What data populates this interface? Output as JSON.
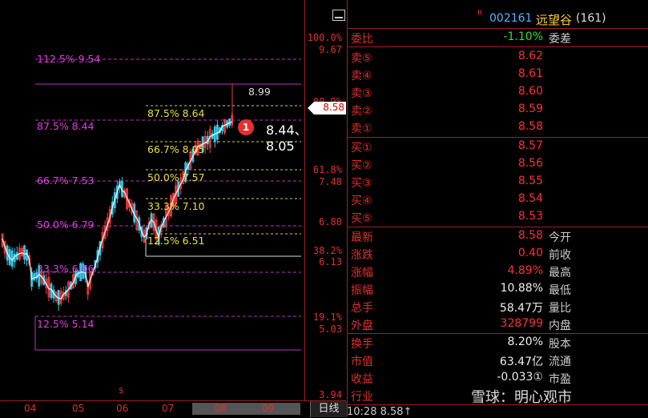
{
  "stock": {
    "code": "002161",
    "name": "远望谷",
    "sub_count": "(161)",
    "r_mark": "R"
  },
  "axis_labels": [
    {
      "text": "100.0%",
      "cls": "red"
    },
    {
      "text": "9.67",
      "cls": "red"
    },
    {
      "text": "80.9%",
      "cls": "red"
    },
    {
      "text": "61.8%",
      "cls": "red"
    },
    {
      "text": "7.48",
      "cls": "red"
    },
    {
      "text": "6.80",
      "cls": "red"
    },
    {
      "text": "38.2%",
      "cls": "red"
    },
    {
      "text": "6.13",
      "cls": "red"
    },
    {
      "text": "19.1%",
      "cls": "red"
    },
    {
      "text": "5.03",
      "cls": "red"
    },
    {
      "text": "3.94",
      "cls": "red"
    }
  ],
  "price_flag": "8.58",
  "fib_outer": [
    "112.5% 9.54",
    "87.5% 8.44",
    "66.7% 7.53",
    "50.0% 6.79",
    "33.3% 6.06",
    "12.5% 5.14"
  ],
  "fib_inner": [
    "87.5% 8.64",
    "66.7% 8.05",
    "50.0% 7.57",
    "33.3% 7.10",
    "12.5% 6.51"
  ],
  "high_label": "8.99",
  "annotation": {
    "badge": "1",
    "text": "8.44、8.05"
  },
  "x_axis": {
    "months": [
      "04",
      "05",
      "06",
      "07",
      "08",
      "09"
    ],
    "marker": "$",
    "day_button": "日线"
  },
  "quote": {
    "weibi": {
      "label": "委比",
      "value": "-1.10%",
      "label2": "委差"
    },
    "sell": [
      {
        "label": "卖⑤",
        "price": "8.62"
      },
      {
        "label": "卖④",
        "price": "8.61"
      },
      {
        "label": "卖③",
        "price": "8.60"
      },
      {
        "label": "卖②",
        "price": "8.59"
      },
      {
        "label": "卖①",
        "price": "8.58"
      }
    ],
    "buy": [
      {
        "label": "买①",
        "price": "8.57"
      },
      {
        "label": "买②",
        "price": "8.56"
      },
      {
        "label": "买③",
        "price": "8.55"
      },
      {
        "label": "买④",
        "price": "8.54"
      },
      {
        "label": "买⑤",
        "price": "8.53"
      }
    ],
    "stats": [
      {
        "k": "最新",
        "v": "8.58",
        "vcls": "red",
        "k2": "今开"
      },
      {
        "k": "涨跌",
        "v": "0.40",
        "vcls": "red",
        "k2": "前收"
      },
      {
        "k": "涨幅",
        "v": "4.89%",
        "vcls": "red",
        "k2": "最高"
      },
      {
        "k": "振幅",
        "v": "10.88%",
        "vcls": "wt",
        "k2": "最低"
      },
      {
        "k": "总手",
        "v": "58.47万",
        "vcls": "wt",
        "k2": "量比"
      },
      {
        "k": "外盘",
        "v": "328799",
        "vcls": "red",
        "k2": "内盘"
      }
    ],
    "fund": [
      {
        "k": "换手",
        "v": "8.20%",
        "vcls": "wt",
        "k2": "股本"
      },
      {
        "k": "市值",
        "v": "63.47亿",
        "vcls": "wt",
        "k2": "流通"
      },
      {
        "k": "收益",
        "v": "-0.033①",
        "vcls": "wt",
        "k2": "市盈"
      },
      {
        "k": "行业",
        "v": "",
        "vcls": "wt",
        "k2": ""
      }
    ]
  },
  "watermark": "雪球：明心观市",
  "time_row": "10:28        8.58↑"
}
